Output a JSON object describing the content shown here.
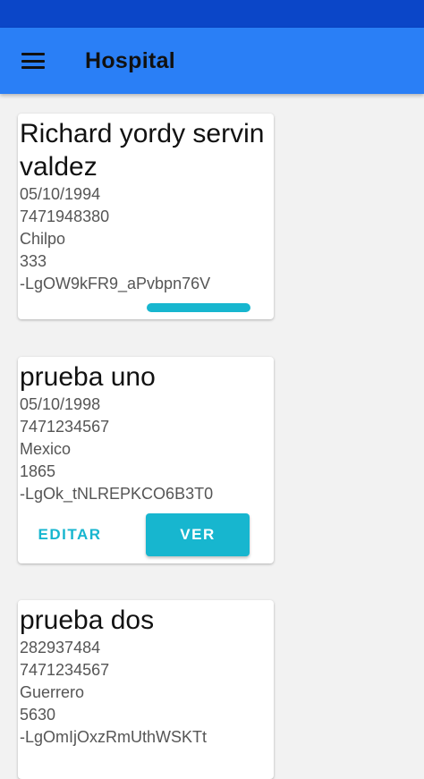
{
  "app": {
    "title": "Hospital",
    "menu_icon": "hamburger-menu-icon",
    "colors": {
      "status_bar": "#0b46c8",
      "app_bar": "#2a7ff6",
      "accent": "#17b6cf",
      "background": "#f2f2f2"
    }
  },
  "patients": [
    {
      "name": "Richard yordy servin valdez",
      "date": "05/10/1994",
      "phone": "7471948380",
      "place": "Chilpo",
      "number": "333",
      "id": "-LgOW9kFR9_aPvbpn76V",
      "state": "loading"
    },
    {
      "name": "prueba uno",
      "date": "05/10/1998",
      "phone": "7471234567",
      "place": "Mexico",
      "number": "1865",
      "id": "-LgOk_tNLREPKCO6B3T0",
      "actions": {
        "edit_label": "EDITAR",
        "view_label": "VER"
      }
    },
    {
      "name": "prueba dos",
      "date": "282937484",
      "phone": "7471234567",
      "place": "Guerrero",
      "number": "5630",
      "id": "-LgOmIjOxzRmUthWSKTt"
    }
  ]
}
